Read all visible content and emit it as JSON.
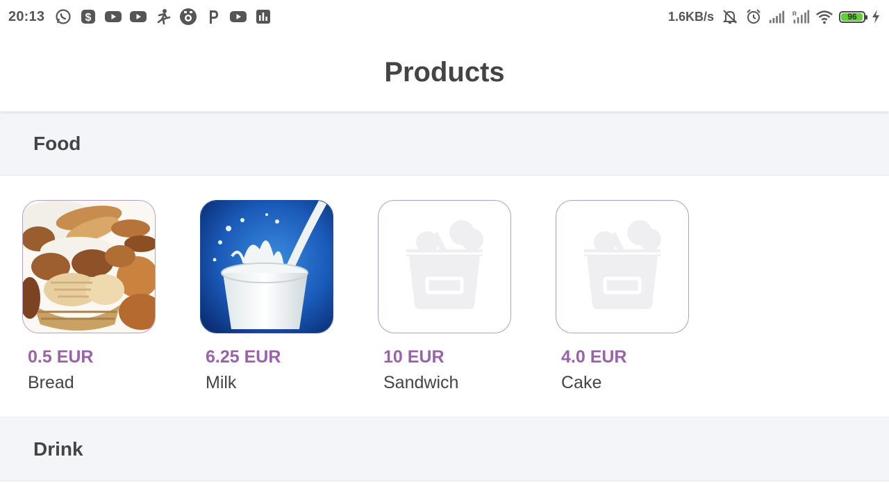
{
  "status_bar": {
    "time": "20:13",
    "left_icons": [
      "whatsapp-icon",
      "dollar-app-icon",
      "youtube-icon",
      "youtube-icon",
      "fitness-icon",
      "camera-icon",
      "paypal-icon",
      "youtube-icon",
      "stats-icon"
    ],
    "speed": "1.6KB/s",
    "right_icons": [
      "mute-icon",
      "alarm-icon",
      "signal-icon",
      "roaming-signal-icon",
      "wifi-icon"
    ],
    "battery_level": "96",
    "battery_fill_fraction": 0.96,
    "charging": true
  },
  "app_bar": {
    "title": "Products"
  },
  "sections": [
    {
      "title": "Food",
      "products": [
        {
          "price": "0.5 EUR",
          "name": "Bread",
          "image": "bread-photo"
        },
        {
          "price": "6.25 EUR",
          "name": "Milk",
          "image": "milk-photo"
        },
        {
          "price": "10 EUR",
          "name": "Sandwich",
          "image": "placeholder-basket-icon"
        },
        {
          "price": "4.0 EUR",
          "name": "Cake",
          "image": "placeholder-basket-icon"
        }
      ]
    },
    {
      "title": "Drink",
      "products": []
    }
  ],
  "colors": {
    "accent_price": "#9a62a8",
    "thumb_border": "#b99ac8",
    "section_bg": "#f4f5f8",
    "battery_green": "#5fd02d"
  }
}
